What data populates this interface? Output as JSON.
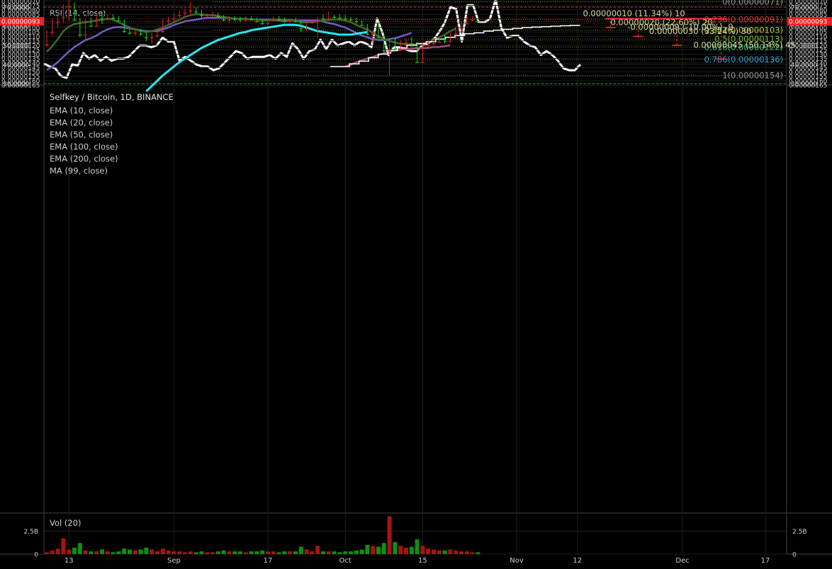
{
  "colors": {
    "background": "#000000",
    "grid": "#1e1e1e",
    "up": "#11e011",
    "down": "#ee2222",
    "ema10": "#3b6b2c",
    "ema20": "#6f5fc0",
    "ema50": "#28e8ec",
    "ma99": "#a34b78",
    "white": "#ffffff",
    "fib_line": "#7a7a2a",
    "zone": "#3d3a00",
    "loss_box": "#7a3030",
    "gain_bar": "#8a8a98",
    "red_dash": "#ff3333",
    "green_dash": "#22aa22",
    "fib_1": "#9a9a9a",
    "fib_0786": "#3aa0d8",
    "fib_0618": "#3cbf7a",
    "fib_05": "#7bbf3c",
    "fib_0382": "#b7c84a",
    "fib_0236": "#d84040",
    "fib_0": "#9a9a9a",
    "price_tag": "#ee2222"
  },
  "chart_data": [
    {
      "type": "line",
      "title": "RSI (14, close)",
      "ylim": [
        30,
        70
      ],
      "y_ticks": [
        "70.0000",
        "60.0000",
        "50.0000",
        "40.0000",
        "30.0000"
      ],
      "y_tick_values": [
        70,
        60,
        50,
        40,
        30
      ],
      "levels": [
        70,
        30
      ],
      "series": [
        {
          "values": [
            40.5,
            39,
            38,
            34,
            33,
            40,
            39.5,
            46,
            43,
            45,
            42,
            44,
            42,
            43,
            43,
            44,
            47,
            50,
            50,
            49,
            50,
            54,
            52,
            52,
            42,
            44,
            42,
            40,
            39,
            39,
            37,
            38,
            41,
            44,
            47,
            46,
            43,
            44,
            44,
            44,
            45,
            43,
            46,
            44,
            51,
            48,
            43,
            47,
            48,
            53,
            48,
            53,
            50,
            51,
            52,
            50,
            52,
            51,
            49,
            64,
            56,
            45,
            49,
            49,
            48,
            47,
            47,
            50,
            51,
            53,
            57,
            62,
            70,
            69,
            52,
            71,
            71,
            62,
            62,
            64,
            74,
            59,
            54,
            55,
            55,
            52,
            50,
            49,
            45,
            47,
            45,
            42,
            38,
            37,
            37,
            40
          ]
        }
      ]
    },
    {
      "type": "candlestick",
      "title": "Selfkey / Bitcoin, 1D, BINANCE",
      "indicators": [
        "EMA (10, close)",
        "EMA (20, close)",
        "EMA (50, close)",
        "EMA (100, close)",
        "EMA (200, close)",
        "MA (99, close)"
      ],
      "ylim": [
        6.45e-07,
        1.665e-07
      ],
      "y_tick_values": [
        1.65e-07,
        1.6e-07,
        1.55e-07,
        1.5e-07,
        1.45e-07,
        1.4e-07,
        1.35e-07,
        1.3e-07,
        1.25e-07,
        1.2e-07,
        1.15e-07,
        1.1e-07,
        1.05e-07,
        1e-07,
        9.5e-08,
        9e-08,
        8.5e-08,
        8e-08,
        7.5e-08,
        7e-08,
        6.5e-08
      ],
      "y_ticks": [
        "0.00000165",
        "0.00000160",
        "0.00000155",
        "0.00000150",
        "0.00000145",
        "0.00000140",
        "0.00000135",
        "0.00000130",
        "0.00000125",
        "0.00000120",
        "0.00000115",
        "0.00000110",
        "0.00000105",
        "0.00000100",
        "0.00000095",
        "0.00000090",
        "0.00000085",
        "0.00000080",
        "0.00000075",
        "0.00000070",
        "0.00000065"
      ],
      "last_price": "0.00000093",
      "last_price_value": 9.3e-08,
      "x_ticks": [
        {
          "label": "13",
          "index": 4
        },
        {
          "label": "Sep",
          "index": 23
        },
        {
          "label": "17",
          "index": 40
        },
        {
          "label": "Oct",
          "index": 54
        },
        {
          "label": "15",
          "index": 68
        },
        {
          "label": "Nov",
          "index": 85
        },
        {
          "label": "12",
          "index": 96
        },
        {
          "label": "Dec",
          "index": 115
        },
        {
          "label": "17",
          "index": 130
        }
      ],
      "candles": [
        [
          1.19e-07,
          1.22e-07,
          1.03e-07,
          1.05e-07
        ],
        [
          1.05e-07,
          1.09e-07,
          9e-08,
          9.4e-08
        ],
        [
          9.4e-08,
          1e-07,
          8.5e-08,
          8.8e-08
        ],
        [
          8.8e-08,
          9.5e-08,
          7.4e-08,
          7.6e-08
        ],
        [
          7.6e-08,
          9.2e-08,
          6.7e-08,
          7.3e-08
        ],
        [
          7.3e-08,
          9.3e-08,
          7.2e-08,
          9.1e-08
        ],
        [
          9.1e-08,
          1.11e-07,
          8.9e-08,
          1.08e-07
        ],
        [
          1.08e-07,
          1.13e-07,
          9e-08,
          9.2e-08
        ],
        [
          9.2e-08,
          9.9e-08,
          8.9e-08,
          9.8e-08
        ],
        [
          9.8e-08,
          9.9e-08,
          8.6e-08,
          8.8e-08
        ],
        [
          8.8e-08,
          9.6e-08,
          8.4e-08,
          9e-08
        ],
        [
          9e-08,
          9.2e-08,
          8.5e-08,
          8.7e-08
        ],
        [
          8.7e-08,
          9.1e-08,
          8.5e-08,
          8.9e-08
        ],
        [
          8.9e-08,
          9.3e-08,
          8.7e-08,
          9.2e-08
        ],
        [
          9.2e-08,
          1.06e-07,
          9.1e-08,
          1.04e-07
        ],
        [
          1.04e-07,
          1.08e-07,
          1.02e-07,
          1.06e-07
        ],
        [
          1.06e-07,
          1.09e-07,
          1.01e-07,
          1.03e-07
        ],
        [
          1.03e-07,
          1.09e-07,
          1.02e-07,
          1.07e-07
        ],
        [
          1.07e-07,
          1.15e-07,
          1.04e-07,
          1.11e-07
        ],
        [
          1.11e-07,
          1.18e-07,
          1.06e-07,
          1.09e-07
        ],
        [
          1.09e-07,
          1.11e-07,
          1.02e-07,
          1.04e-07
        ],
        [
          1.04e-07,
          1.06e-07,
          9e-08,
          9.2e-08
        ],
        [
          9.2e-08,
          9.6e-08,
          8.8e-08,
          9e-08
        ],
        [
          9e-08,
          9.3e-08,
          8.4e-08,
          8.6e-08
        ],
        [
          8.6e-08,
          8.9e-08,
          8.1e-08,
          8.3e-08
        ],
        [
          8.3e-08,
          8.7e-08,
          7.9e-08,
          8.1e-08
        ],
        [
          8.1e-08,
          8.6e-08,
          7.1e-08,
          7.8e-08
        ],
        [
          7.8e-08,
          8.4e-08,
          7.7e-08,
          8.2e-08
        ],
        [
          8.2e-08,
          8.9e-08,
          8e-08,
          8.6e-08
        ],
        [
          8.6e-08,
          9.1e-08,
          8.4e-08,
          8.5e-08
        ],
        [
          8.5e-08,
          8.8e-08,
          8.2e-08,
          8.4e-08
        ],
        [
          8.4e-08,
          9e-08,
          8.3e-08,
          8.7e-08
        ],
        [
          8.7e-08,
          9.3e-08,
          8.6e-08,
          9.1e-08
        ],
        [
          9.1e-08,
          9.5e-08,
          8.7e-08,
          8.8e-08
        ],
        [
          8.8e-08,
          9.3e-08,
          8.7e-08,
          9e-08
        ],
        [
          9e-08,
          9.4e-08,
          8.8e-08,
          9.1e-08
        ],
        [
          9.1e-08,
          9.3e-08,
          8.7e-08,
          8.8e-08
        ],
        [
          8.8e-08,
          9.2e-08,
          8.7e-08,
          9e-08
        ],
        [
          9e-08,
          9.4e-08,
          8.9e-08,
          9.3e-08
        ],
        [
          9.3e-08,
          9.7e-08,
          9.1e-08,
          9.5e-08
        ],
        [
          9.5e-08,
          9.7e-08,
          9.1e-08,
          9.2e-08
        ],
        [
          9.2e-08,
          9.3e-08,
          8.7e-08,
          8.8e-08
        ],
        [
          8.8e-08,
          9.2e-08,
          8.7e-08,
          9.1e-08
        ],
        [
          9.1e-08,
          9.4e-08,
          8.9e-08,
          9.2e-08
        ],
        [
          9.2e-08,
          9.5e-08,
          9e-08,
          9.1e-08
        ],
        [
          9.1e-08,
          9.4e-08,
          8.9e-08,
          9.3e-08
        ],
        [
          9.3e-08,
          1.05e-07,
          9.2e-08,
          1.01e-07
        ],
        [
          1.01e-07,
          1.04e-07,
          9.3e-08,
          9.4e-08
        ],
        [
          9.4e-08,
          9.6e-08,
          9.1e-08,
          9.3e-08
        ],
        [
          9.3e-08,
          1.11e-07,
          8.8e-08,
          8.8e-08
        ],
        [
          8.8e-08,
          9.1e-08,
          8.5e-08,
          9e-08
        ],
        [
          9e-08,
          9.3e-08,
          8.2e-08,
          8.8e-08
        ],
        [
          8.8e-08,
          9e-08,
          8.6e-08,
          8.8e-08
        ],
        [
          8.8e-08,
          9.1e-08,
          8.5e-08,
          8.9e-08
        ],
        [
          8.9e-08,
          9.2e-08,
          8.6e-08,
          9e-08
        ],
        [
          9e-08,
          9.3e-08,
          8.8e-08,
          9.1e-08
        ],
        [
          9.1e-08,
          9.5e-08,
          8.9e-08,
          9.3e-08
        ],
        [
          9.3e-08,
          9.8e-08,
          9.2e-08,
          9.7e-08
        ],
        [
          9.7e-08,
          1.09e-07,
          9.6e-08,
          1.07e-07
        ],
        [
          1.07e-07,
          1.18e-07,
          1.04e-07,
          9.9e-08
        ],
        [
          9.9e-08,
          1.12e-07,
          9.6e-08,
          1.11e-07
        ],
        [
          1.11e-07,
          1.28e-07,
          1.08e-07,
          1.26e-07
        ],
        [
          1.26e-07,
          1.54e-07,
          1.15e-07,
          1.18e-07
        ],
        [
          1.18e-07,
          1.27e-07,
          1.12e-07,
          1.24e-07
        ],
        [
          1.24e-07,
          1.26e-07,
          1.14e-07,
          1.17e-07
        ],
        [
          1.17e-07,
          1.23e-07,
          1.12e-07,
          1.14e-07
        ],
        [
          1.14e-07,
          1.22e-07,
          1.11e-07,
          1.18e-07
        ],
        [
          1.18e-07,
          1.4e-07,
          1.16e-07,
          1.39e-07
        ],
        [
          1.39e-07,
          1.39e-07,
          1.17e-07,
          1.2e-07
        ],
        [
          1.2e-07,
          1.23e-07,
          1.14e-07,
          1.18e-07
        ],
        [
          1.18e-07,
          1.2e-07,
          1.12e-07,
          1.16e-07
        ],
        [
          1.16e-07,
          1.18e-07,
          1.11e-07,
          1.13e-07
        ],
        [
          1.13e-07,
          1.18e-07,
          1.09e-07,
          1.15e-07
        ],
        [
          1.15e-07,
          1.17e-07,
          1.06e-07,
          1.07e-07
        ],
        [
          1.07e-07,
          1.12e-07,
          9.9e-08,
          1.01e-07
        ],
        [
          1.01e-07,
          1.04e-07,
          9.3e-08,
          9.5e-08
        ],
        [
          9.5e-08,
          9.7e-08,
          8.7e-08,
          9.1e-08
        ],
        [
          9.1e-08,
          9.3e-08,
          8.7e-08,
          9e-08
        ],
        [
          9e-08,
          9.4e-08,
          8.9e-08,
          9.3e-08
        ]
      ],
      "candle_start_index": 0,
      "ema10": [
        1.275e-07,
        1.21e-07,
        1.13e-07,
        1.04e-07,
        9.9e-08,
        9.6e-08,
        9.5e-08,
        9.4e-08,
        9.3e-08,
        9.2e-08,
        9.1e-08,
        9e-08,
        9.1e-08,
        9.4e-08,
        9.7e-08,
        1e-07,
        1.02e-07,
        1.04e-07,
        1.05e-07,
        1.04e-07,
        1.02e-07,
        1e-07,
        9.7e-08,
        9.4e-08,
        9.1e-08,
        8.8e-08,
        8.6e-08,
        8.5e-08,
        8.5e-08,
        8.6e-08,
        8.6e-08,
        8.7e-08,
        8.8e-08,
        8.9e-08,
        9e-08,
        9e-08,
        9e-08,
        9.1e-08,
        9.1e-08,
        9.2e-08,
        9.2e-08,
        9.1e-08,
        9.1e-08,
        9.1e-08,
        9.1e-08,
        9.2e-08,
        9.4e-08,
        9.4e-08,
        9.4e-08,
        9.3e-08,
        9.2e-08,
        9.1e-08,
        9.1e-08,
        9.1e-08,
        9.2e-08,
        9.4e-08,
        9.7e-08,
        1e-07,
        1.02e-07,
        1.06e-07,
        1.1e-07,
        1.13e-07,
        1.15e-07,
        1.17e-07,
        1.18e-07,
        1.19e-07,
        1.19e-07,
        1.19e-07,
        1.18e-07,
        1.17e-07,
        1.14e-07,
        1.11e-07,
        1.08e-07,
        1.04e-07,
        1.01e-07
      ],
      "ema10_start": 0,
      "ema20": [
        1.48e-07,
        1.44e-07,
        1.39e-07,
        1.33e-07,
        1.27e-07,
        1.22e-07,
        1.18e-07,
        1.14e-07,
        1.12e-07,
        1.09e-07,
        1.05e-07,
        1.02e-07,
        1e-07,
        9.95e-08,
        1e-07,
        1.01e-07,
        1.02e-07,
        1.03e-07,
        1.04e-07,
        1.04e-07,
        1.04e-07,
        1.02e-07,
        1e-07,
        9.7e-08,
        9.5e-08,
        9.3e-08,
        9.2e-08,
        9.1e-08,
        9e-08,
        8.9e-08,
        8.9e-08,
        8.9e-08,
        8.9e-08,
        8.9e-08,
        9e-08,
        9e-08,
        9e-08,
        9.1e-08,
        9.1e-08,
        9.1e-08,
        9.1e-08,
        9.1e-08,
        9.2e-08,
        9.3e-08,
        9.2e-08,
        9.2e-08,
        9.2e-08,
        9.2e-08,
        9.2e-08,
        9.2e-08,
        9.3e-08,
        9.5e-08,
        9.6e-08,
        9.8e-08,
        1e-07,
        1.03e-07,
        1.06e-07,
        1.09e-07,
        1.11e-07,
        1.13e-07,
        1.14e-07,
        1.14e-07,
        1.13e-07,
        1.12e-07,
        1.1e-07,
        1.08e-07,
        1.06e-07
      ],
      "ema20_start": 0,
      "ema50": [
        1.72e-07,
        1.66e-07,
        1.6e-07,
        1.54e-07,
        1.49e-07,
        1.44e-07,
        1.39e-07,
        1.35e-07,
        1.31e-07,
        1.27e-07,
        1.23e-07,
        1.2e-07,
        1.17e-07,
        1.14e-07,
        1.12e-07,
        1.1e-07,
        1.08e-07,
        1.06e-07,
        1.05e-07,
        1.03e-07,
        1.02e-07,
        1.01e-07,
        1e-07,
        9.9e-08,
        9.8e-08,
        9.7e-08,
        9.7e-08,
        9.7e-08,
        9.8e-08,
        1e-07,
        1.02e-07,
        1.04e-07,
        1.05e-07,
        1.06e-07,
        1.07e-07,
        1.08e-07,
        1.08e-07,
        1.08e-07,
        1.07e-07,
        1.06e-07,
        1.05e-07
      ],
      "ema50_start": 18,
      "ma99": [
        1.44e-07,
        1.42e-07,
        1.39e-07,
        1.37e-07,
        1.35e-07,
        1.33e-07,
        1.31e-07,
        1.29e-07,
        1.27e-07,
        1.26e-07,
        1.25e-07,
        1.24e-07,
        1.24e-07,
        1.23e-07,
        1.23e-07,
        1.23e-07,
        1.22e-07,
        1.22e-07,
        1.21e-07,
        1.2e-07
      ],
      "ma99_start": 54,
      "white_line": [
        1.44e-07,
        1.44e-07,
        1.41e-07,
        1.38e-07,
        1.34e-07,
        1.3e-07,
        1.26e-07,
        1.23e-07,
        1.2e-07,
        1.18e-07,
        1.16e-07,
        1.13e-07,
        1.11e-07,
        1.09e-07,
        1.07e-07,
        1.06e-07,
        1.04e-07,
        1.03e-07,
        1.02e-07,
        1.01e-07,
        1e-07,
        9.95e-08,
        9.9e-08,
        9.85e-08,
        9.8e-08,
        9.75e-08,
        9.7e-08
      ],
      "white_line_start": 54,
      "fib_levels": [
        {
          "label": "1(0.00000154)",
          "value": 1.54e-07,
          "color_key": "fib_1"
        },
        {
          "label": "0.786(0.00000136)",
          "value": 1.36e-07,
          "color_key": "fib_0786"
        },
        {
          "label": "0.618(0.00000122)",
          "value": 1.22e-07,
          "color_key": "fib_0618"
        },
        {
          "label": "0.5(0.00000113)",
          "value": 1.13e-07,
          "color_key": "fib_05"
        },
        {
          "label": "0.382(0.00000103)",
          "value": 1.03e-07,
          "color_key": "fib_0382"
        },
        {
          "label": "0.236(0.00000091)",
          "value": 9.1e-08,
          "color_key": "fib_0236"
        },
        {
          "label": "0(0.00000071)",
          "value": 7.1e-08,
          "color_key": "fib_0"
        }
      ],
      "support_zone": [
        8.2e-08,
        9e-08
      ],
      "targets": [
        {
          "label": "0.00000010 (11.34%) 10",
          "from": 9e-08,
          "to": 1e-07,
          "index": 102
        },
        {
          "label": "0.00000020 (22.60%) 20",
          "from": 9e-08,
          "to": 1.1e-07,
          "index": 107
        },
        {
          "label": "0.00000030 (33.24%) 30",
          "from": 9e-08,
          "to": 1.2e-07,
          "index": 114
        },
        {
          "label": "0.00000045 (50.14%) 45",
          "from": 9e-08,
          "to": 1.355e-07,
          "index": 122
        }
      ],
      "loss": {
        "label": "-0.00000009 (-10.00%) -9",
        "from": 9e-08,
        "to": 8.1e-08,
        "start_index": 102,
        "end_index": 123
      }
    },
    {
      "type": "bar",
      "title": "Vol (20)",
      "y_ticks": [
        "2.5B",
        "0"
      ],
      "y_tick_values": [
        2.5,
        0
      ],
      "ylim": [
        0,
        4.3
      ],
      "values": [
        0.2,
        0.4,
        0.6,
        1.7,
        0.5,
        0.7,
        1.2,
        0.4,
        0.3,
        0.3,
        0.5,
        0.3,
        0.2,
        0.3,
        0.6,
        0.5,
        0.4,
        0.5,
        0.7,
        0.5,
        0.3,
        0.6,
        0.4,
        0.3,
        0.3,
        0.2,
        0.3,
        0.2,
        0.3,
        0.2,
        0.2,
        0.3,
        0.4,
        0.3,
        0.3,
        0.3,
        0.2,
        0.3,
        0.3,
        0.4,
        0.3,
        0.3,
        0.2,
        0.3,
        0.3,
        0.3,
        0.8,
        0.5,
        0.3,
        0.9,
        0.3,
        0.3,
        0.3,
        0.2,
        0.3,
        0.3,
        0.4,
        0.5,
        1.0,
        0.9,
        0.8,
        1.2,
        4.1,
        1.3,
        0.9,
        0.7,
        0.8,
        1.6,
        0.9,
        0.6,
        0.5,
        0.4,
        0.4,
        0.5,
        0.4,
        0.3,
        0.3,
        0.2,
        0.2
      ]
    }
  ]
}
